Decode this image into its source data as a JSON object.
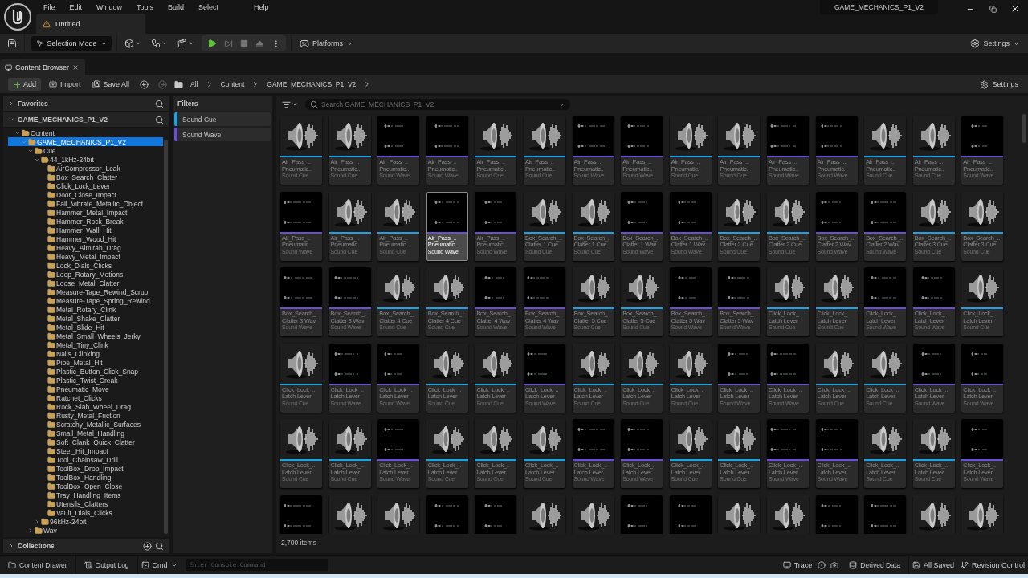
{
  "app": {
    "project": "GAME_MECHANICS_P1_V2"
  },
  "menu": [
    "File",
    "Edit",
    "Window",
    "Tools",
    "Build",
    "Select",
    "Help"
  ],
  "document_tab": {
    "title": "Untitled"
  },
  "toolbar": {
    "mode": "Selection Mode",
    "platforms": "Platforms",
    "settings": "Settings"
  },
  "panel_tab": {
    "title": "Content Browser"
  },
  "browser_toolbar": {
    "add": "Add",
    "import": "Import",
    "save_all": "Save All",
    "breadcrumbs": [
      "All",
      "Content",
      "GAME_MECHANICS_P1_V2"
    ],
    "settings": "Settings"
  },
  "sources": {
    "favorites": "Favorites",
    "project": "GAME_MECHANICS_P1_V2",
    "collections": "Collections",
    "tree": [
      {
        "label": "Content",
        "expanded": true,
        "selected": false,
        "children": [
          {
            "label": "GAME_MECHANICS_P1_V2",
            "expanded": true,
            "selected": true,
            "children": [
              {
                "label": "Cue",
                "expanded": true,
                "selected": false,
                "children": [
                  {
                    "label": "44_1kHz-24bit",
                    "expanded": true,
                    "selected": false,
                    "children": [
                      {
                        "label": "AirCompressor_Leak",
                        "selected": false
                      },
                      {
                        "label": "Box_Search_Clatter",
                        "selected": false
                      },
                      {
                        "label": "Click_Lock_Lever",
                        "selected": false
                      },
                      {
                        "label": "Door_Close_Impact",
                        "selected": false
                      },
                      {
                        "label": "Fall_Vibrate_Metallic_Object",
                        "selected": false
                      },
                      {
                        "label": "Hammer_Metal_Impact",
                        "selected": false
                      },
                      {
                        "label": "Hammer_Rock_Break",
                        "selected": false
                      },
                      {
                        "label": "Hammer_Wall_Hit",
                        "selected": false
                      },
                      {
                        "label": "Hammer_Wood_Hit",
                        "selected": false
                      },
                      {
                        "label": "Heavy_Almirah_Drag",
                        "selected": false
                      },
                      {
                        "label": "Heavy_Metal_Impact",
                        "selected": false
                      },
                      {
                        "label": "Lock_Dials_Clicks",
                        "selected": false
                      },
                      {
                        "label": "Loop_Rotary_Motions",
                        "selected": false
                      },
                      {
                        "label": "Loose_Metal_Clatter",
                        "selected": false
                      },
                      {
                        "label": "Measure-Tape_Rewind_Scrub",
                        "selected": false
                      },
                      {
                        "label": "Measure-Tape_Spring_Rewind",
                        "selected": false
                      },
                      {
                        "label": "Metal_Rotary_Clink",
                        "selected": false
                      },
                      {
                        "label": "Metal_Shake_Clatter",
                        "selected": false
                      },
                      {
                        "label": "Metal_Slide_Hit",
                        "selected": false
                      },
                      {
                        "label": "Metal_Small_Wheels_Jerky",
                        "selected": false
                      },
                      {
                        "label": "Metal_Tiny_Clink",
                        "selected": false
                      },
                      {
                        "label": "Nails_Clinking",
                        "selected": false
                      },
                      {
                        "label": "Pipe_Metal_Hit",
                        "selected": false
                      },
                      {
                        "label": "Plastic_Button_Click_Snap",
                        "selected": false
                      },
                      {
                        "label": "Plastic_Twist_Creak",
                        "selected": false
                      },
                      {
                        "label": "Pneumatic_Move",
                        "selected": false
                      },
                      {
                        "label": "Ratchet_Clicks",
                        "selected": false
                      },
                      {
                        "label": "Rock_Slab_Wheel_Drag",
                        "selected": false
                      },
                      {
                        "label": "Rusty_Metal_Friction",
                        "selected": false
                      },
                      {
                        "label": "Scratchy_Metallic_Surfaces",
                        "selected": false
                      },
                      {
                        "label": "Small_Metal_Handling",
                        "selected": false
                      },
                      {
                        "label": "Soft_Clank_Quick_Clatter",
                        "selected": false
                      },
                      {
                        "label": "Steel_Hit_Impact",
                        "selected": false
                      },
                      {
                        "label": "Tool_Chainsaw_Drill",
                        "selected": false
                      },
                      {
                        "label": "ToolBox_Drop_Impact",
                        "selected": false
                      },
                      {
                        "label": "ToolBox_Handling",
                        "selected": false
                      },
                      {
                        "label": "ToolBox_Open_Close",
                        "selected": false
                      },
                      {
                        "label": "Tray_Handling_Items",
                        "selected": false
                      },
                      {
                        "label": "Utensils_Clatters",
                        "selected": false
                      },
                      {
                        "label": "Vault_Dials_Clicks",
                        "selected": false
                      }
                    ]
                  },
                  {
                    "label": "96kHz-24bit",
                    "expanded": false,
                    "selected": false
                  }
                ]
              },
              {
                "label": "Wav",
                "expanded": false,
                "selected": false
              }
            ]
          }
        ]
      }
    ]
  },
  "filters": {
    "title": "Filters",
    "items": [
      {
        "label": "Sound Cue",
        "color": "#1aa3e6"
      },
      {
        "label": "Sound Wave",
        "color": "#6b4fd3"
      }
    ]
  },
  "search": {
    "placeholder": "Search GAME_MECHANICS_P1_V2"
  },
  "assets": [
    {
      "kind": "cue",
      "name": "Air_Pass_..",
      "detail": "Pneumatic..",
      "type": "Sound Cue",
      "selected": false
    },
    {
      "kind": "cue",
      "name": "Air_Pass_..",
      "detail": "Pneumatic..",
      "type": "Sound Cue",
      "selected": false
    },
    {
      "kind": "wave",
      "name": "Air_Pass_..",
      "detail": "Pneumatic..",
      "type": "Sound Wave",
      "selected": false
    },
    {
      "kind": "wave",
      "name": "Air_Pass_..",
      "detail": "Pneumatic..",
      "type": "Sound Wave",
      "selected": false
    },
    {
      "kind": "cue",
      "name": "Air_Pass_..",
      "detail": "Pneumatic..",
      "type": "Sound Cue",
      "selected": false
    },
    {
      "kind": "cue",
      "name": "Air_Pass_..",
      "detail": "Pneumatic..",
      "type": "Sound Cue",
      "selected": false
    },
    {
      "kind": "wave",
      "name": "Air_Pass_..",
      "detail": "Pneumatic..",
      "type": "Sound Wave",
      "selected": false
    },
    {
      "kind": "wave",
      "name": "Air_Pass_..",
      "detail": "Pneumatic..",
      "type": "Sound Wave",
      "selected": false
    },
    {
      "kind": "cue",
      "name": "Air_Pass_..",
      "detail": "Pneumatic..",
      "type": "Sound Cue",
      "selected": false
    },
    {
      "kind": "cue",
      "name": "Air_Pass_..",
      "detail": "Pneumatic..",
      "type": "Sound Cue",
      "selected": false
    },
    {
      "kind": "wave",
      "name": "Air_Pass_..",
      "detail": "Pneumatic..",
      "type": "Sound Wave",
      "selected": false
    },
    {
      "kind": "wave",
      "name": "Air_Pass_..",
      "detail": "Pneumatic..",
      "type": "Sound Wave",
      "selected": false
    },
    {
      "kind": "cue",
      "name": "Air_Pass_..",
      "detail": "Pneumatic..",
      "type": "Sound Cue",
      "selected": false
    },
    {
      "kind": "cue",
      "name": "Air_Pass_..",
      "detail": "Pneumatic..",
      "type": "Sound Cue",
      "selected": false
    },
    {
      "kind": "wave",
      "name": "Air_Pass_..",
      "detail": "Pneumatic..",
      "type": "Sound Wave",
      "selected": false
    },
    {
      "kind": "wave",
      "name": "Air_Pass_..",
      "detail": "Pneumatic..",
      "type": "Sound Wave",
      "selected": false
    },
    {
      "kind": "cue",
      "name": "Air_Pass_..",
      "detail": "Pneumatic..",
      "type": "Sound Cue",
      "selected": false
    },
    {
      "kind": "cue",
      "name": "Air_Pass_..",
      "detail": "Pneumatic..",
      "type": "Sound Cue",
      "selected": false
    },
    {
      "kind": "wave",
      "name": "Air_Pass_..",
      "detail": "Pneumatic..",
      "type": "Sound Wave",
      "selected": true
    },
    {
      "kind": "wave",
      "name": "Air_Pass_..",
      "detail": "Pneumatic..",
      "type": "Sound Wave",
      "selected": false
    },
    {
      "kind": "cue",
      "name": "Box_Search_..",
      "detail": "Clatter 1 Cue",
      "type": "Sound Cue",
      "selected": false
    },
    {
      "kind": "cue",
      "name": "Box_Search_..",
      "detail": "Clatter 1 Cue",
      "type": "Sound Cue",
      "selected": false
    },
    {
      "kind": "wave",
      "name": "Box_Search_..",
      "detail": "Clatter 1 Wav",
      "type": "Sound Wave",
      "selected": false
    },
    {
      "kind": "wave",
      "name": "Box_Search_..",
      "detail": "Clatter 1 Wav",
      "type": "Sound Wave",
      "selected": false
    },
    {
      "kind": "cue",
      "name": "Box_Search_..",
      "detail": "Clatter 2 Cue",
      "type": "Sound Cue",
      "selected": false
    },
    {
      "kind": "cue",
      "name": "Box_Search_..",
      "detail": "Clatter 2 Cue",
      "type": "Sound Cue",
      "selected": false
    },
    {
      "kind": "wave",
      "name": "Box_Search_..",
      "detail": "Clatter 2 Wav",
      "type": "Sound Wave",
      "selected": false
    },
    {
      "kind": "wave",
      "name": "Box_Search_..",
      "detail": "Clatter 2 Wav",
      "type": "Sound Wave",
      "selected": false
    },
    {
      "kind": "cue",
      "name": "Box_Search_..",
      "detail": "Clatter 3 Cue",
      "type": "Sound Cue",
      "selected": false
    },
    {
      "kind": "cue",
      "name": "Box_Search_..",
      "detail": "Clatter 3 Cue",
      "type": "Sound Cue",
      "selected": false
    },
    {
      "kind": "wave",
      "name": "Box_Search_..",
      "detail": "Clatter 3 Wav",
      "type": "Sound Wave",
      "selected": false
    },
    {
      "kind": "wave",
      "name": "Box_Search_..",
      "detail": "Clatter 3 Wav",
      "type": "Sound Wave",
      "selected": false
    },
    {
      "kind": "cue",
      "name": "Box_Search_..",
      "detail": "Clatter 4 Cue",
      "type": "Sound Cue",
      "selected": false
    },
    {
      "kind": "cue",
      "name": "Box_Search_..",
      "detail": "Clatter 4 Cue",
      "type": "Sound Cue",
      "selected": false
    },
    {
      "kind": "wave",
      "name": "Box_Search_..",
      "detail": "Clatter 4 Wav",
      "type": "Sound Wave",
      "selected": false
    },
    {
      "kind": "wave",
      "name": "Box_Search_..",
      "detail": "Clatter 4 Wav",
      "type": "Sound Wave",
      "selected": false
    },
    {
      "kind": "cue",
      "name": "Box_Search_..",
      "detail": "Clatter 5 Cue",
      "type": "Sound Cue",
      "selected": false
    },
    {
      "kind": "cue",
      "name": "Box_Search_..",
      "detail": "Clatter 5 Cue",
      "type": "Sound Cue",
      "selected": false
    },
    {
      "kind": "wave",
      "name": "Box_Search_..",
      "detail": "Clatter 5 Wav",
      "type": "Sound Wave",
      "selected": false
    },
    {
      "kind": "wave",
      "name": "Box_Search_..",
      "detail": "Clatter 5 Wav",
      "type": "Sound Wave",
      "selected": false
    },
    {
      "kind": "cue",
      "name": "Click_Lock_..",
      "detail": "Latch Lever",
      "type": "Sound Cue",
      "selected": false
    },
    {
      "kind": "cue",
      "name": "Click_Lock_..",
      "detail": "Latch Lever",
      "type": "Sound Cue",
      "selected": false
    },
    {
      "kind": "wave",
      "name": "Click_Lock_..",
      "detail": "Latch Lever",
      "type": "Sound Wave",
      "selected": false
    },
    {
      "kind": "wave",
      "name": "Click_Lock_..",
      "detail": "Latch Lever",
      "type": "Sound Wave",
      "selected": false
    },
    {
      "kind": "cue",
      "name": "Click_Lock_..",
      "detail": "Latch Lever",
      "type": "Sound Cue",
      "selected": false
    },
    {
      "kind": "cue",
      "name": "Click_Lock_..",
      "detail": "Latch Lever",
      "type": "Sound Cue",
      "selected": false
    },
    {
      "kind": "wave",
      "name": "Click_Lock_..",
      "detail": "Latch Lever",
      "type": "Sound Wave",
      "selected": false
    },
    {
      "kind": "wave",
      "name": "Click_Lock_..",
      "detail": "Latch Lever",
      "type": "Sound Wave",
      "selected": false
    },
    {
      "kind": "cue",
      "name": "Click_Lock_..",
      "detail": "Latch Lever",
      "type": "Sound Cue",
      "selected": false
    },
    {
      "kind": "cue",
      "name": "Click_Lock_..",
      "detail": "Latch Lever",
      "type": "Sound Cue",
      "selected": false
    },
    {
      "kind": "wave",
      "name": "Click_Lock_..",
      "detail": "Latch Lever",
      "type": "Sound Wave",
      "selected": false
    },
    {
      "kind": "cue",
      "name": "Click_Lock_..",
      "detail": "Latch Lever",
      "type": "Sound Cue",
      "selected": false
    },
    {
      "kind": "cue",
      "name": "Click_Lock_..",
      "detail": "Latch Lever",
      "type": "Sound Cue",
      "selected": false
    },
    {
      "kind": "cue",
      "name": "Click_Lock_..",
      "detail": "Latch Lever",
      "type": "Sound Cue",
      "selected": false
    },
    {
      "kind": "wave",
      "name": "Click_Lock_..",
      "detail": "Latch Lever",
      "type": "Sound Wave",
      "selected": false
    },
    {
      "kind": "wave",
      "name": "Click_Lock_..",
      "detail": "Latch Lever",
      "type": "Sound Wave",
      "selected": false
    },
    {
      "kind": "cue",
      "name": "Click_Lock_..",
      "detail": "Latch Lever",
      "type": "Sound Cue",
      "selected": false
    },
    {
      "kind": "cue",
      "name": "Click_Lock_..",
      "detail": "Latch Lever",
      "type": "Sound Cue",
      "selected": false
    },
    {
      "kind": "wave",
      "name": "Click_Lock_..",
      "detail": "Latch Lever",
      "type": "Sound Wave",
      "selected": false
    },
    {
      "kind": "wave",
      "name": "Click_Lock_..",
      "detail": "Latch Lever",
      "type": "Sound Wave",
      "selected": false
    },
    {
      "kind": "cue",
      "name": "Click_Lock_..",
      "detail": "Latch Lever",
      "type": "Sound Cue",
      "selected": false
    },
    {
      "kind": "cue",
      "name": "Click_Lock_..",
      "detail": "Latch Lever",
      "type": "Sound Cue",
      "selected": false
    },
    {
      "kind": "wave",
      "name": "Click_Lock_..",
      "detail": "Latch Lever",
      "type": "Sound Wave",
      "selected": false
    },
    {
      "kind": "cue",
      "name": "Click_Lock_..",
      "detail": "Latch Lever",
      "type": "Sound Cue",
      "selected": false
    },
    {
      "kind": "cue",
      "name": "Click_Lock_..",
      "detail": "Latch Lever",
      "type": "Sound Cue",
      "selected": false
    },
    {
      "kind": "cue",
      "name": "Click_Lock_..",
      "detail": "Latch Lever",
      "type": "Sound Cue",
      "selected": false
    },
    {
      "kind": "wave",
      "name": "Click_Lock_..",
      "detail": "Latch Lever",
      "type": "Sound Wave",
      "selected": false
    },
    {
      "kind": "wave",
      "name": "Click_Lock_..",
      "detail": "Latch Lever",
      "type": "Sound Wave",
      "selected": false
    },
    {
      "kind": "cue",
      "name": "Click_Lock_..",
      "detail": "Latch Lever",
      "type": "Sound Cue",
      "selected": false
    },
    {
      "kind": "cue",
      "name": "Click_Lock_..",
      "detail": "Latch Lever",
      "type": "Sound Cue",
      "selected": false
    },
    {
      "kind": "wave",
      "name": "Click_Lock_..",
      "detail": "Latch Lever",
      "type": "Sound Wave",
      "selected": false
    },
    {
      "kind": "wave",
      "name": "Click_Lock_..",
      "detail": "Latch Lever",
      "type": "Sound Wave",
      "selected": false
    },
    {
      "kind": "cue",
      "name": "Click_Lock_..",
      "detail": "Latch Lever",
      "type": "Sound Cue",
      "selected": false
    },
    {
      "kind": "cue",
      "name": "Click_Lock_..",
      "detail": "Latch Lever",
      "type": "Sound Cue",
      "selected": false
    },
    {
      "kind": "wave",
      "name": "Click_Lock_..",
      "detail": "Latch Lever",
      "type": "Sound Wave",
      "selected": false
    },
    {
      "kind": "wave",
      "selected": false
    },
    {
      "kind": "cue",
      "selected": false
    },
    {
      "kind": "cue",
      "selected": false
    },
    {
      "kind": "wave",
      "selected": false
    },
    {
      "kind": "wave",
      "selected": false
    },
    {
      "kind": "cue",
      "selected": false
    },
    {
      "kind": "cue",
      "selected": false
    },
    {
      "kind": "wave",
      "selected": false
    },
    {
      "kind": "wave",
      "selected": false
    },
    {
      "kind": "cue",
      "selected": false
    },
    {
      "kind": "cue",
      "selected": false
    },
    {
      "kind": "wave",
      "selected": false
    },
    {
      "kind": "wave",
      "selected": false
    },
    {
      "kind": "cue",
      "selected": false
    },
    {
      "kind": "cue",
      "selected": false
    }
  ],
  "item_count": "2,700 items",
  "status_bar": {
    "content_drawer": "Content Drawer",
    "output_log": "Output Log",
    "cmd": "Cmd",
    "console": {
      "placeholder": "Enter Console Command"
    },
    "trace": "Trace",
    "derived_data": "Derived Data",
    "save_state": "All Saved",
    "revision_control": "Revision Control"
  }
}
